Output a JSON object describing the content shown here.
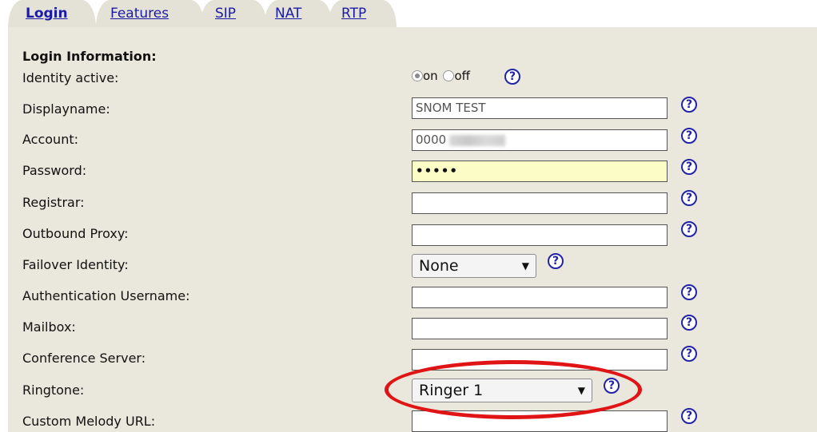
{
  "tabs": [
    {
      "label": "Login",
      "active": true
    },
    {
      "label": "Features",
      "active": false
    },
    {
      "label": "SIP",
      "active": false
    },
    {
      "label": "NAT",
      "active": false
    },
    {
      "label": "RTP",
      "active": false
    }
  ],
  "section_title": "Login Information:",
  "rows": {
    "identity_active": {
      "label": "Identity active:",
      "on_label": "on",
      "off_label": "off",
      "selected": "on"
    },
    "displayname": {
      "label": "Displayname:",
      "value": "SNOM TEST"
    },
    "account": {
      "label": "Account:",
      "value": "0000"
    },
    "password": {
      "label": "Password:",
      "value": "•••••"
    },
    "registrar": {
      "label": "Registrar:",
      "value": ""
    },
    "outbound_proxy": {
      "label": "Outbound Proxy:",
      "value": ""
    },
    "failover_identity": {
      "label": "Failover Identity:",
      "value": "None"
    },
    "auth_username": {
      "label": "Authentication Username:",
      "value": ""
    },
    "mailbox": {
      "label": "Mailbox:",
      "value": ""
    },
    "conference_server": {
      "label": "Conference Server:",
      "value": ""
    },
    "ringtone": {
      "label": "Ringtone:",
      "value": "Ringer 1"
    },
    "custom_melody_url": {
      "label": "Custom Melody URL:",
      "value": ""
    }
  },
  "help_glyph": "?",
  "select_arrow": "▼",
  "colors": {
    "panel": "#eae8dc",
    "tab": "#e4e2d6",
    "link": "#1a1aa6",
    "highlight_ellipse": "#e01414",
    "password_bg": "#fcfcc6"
  }
}
